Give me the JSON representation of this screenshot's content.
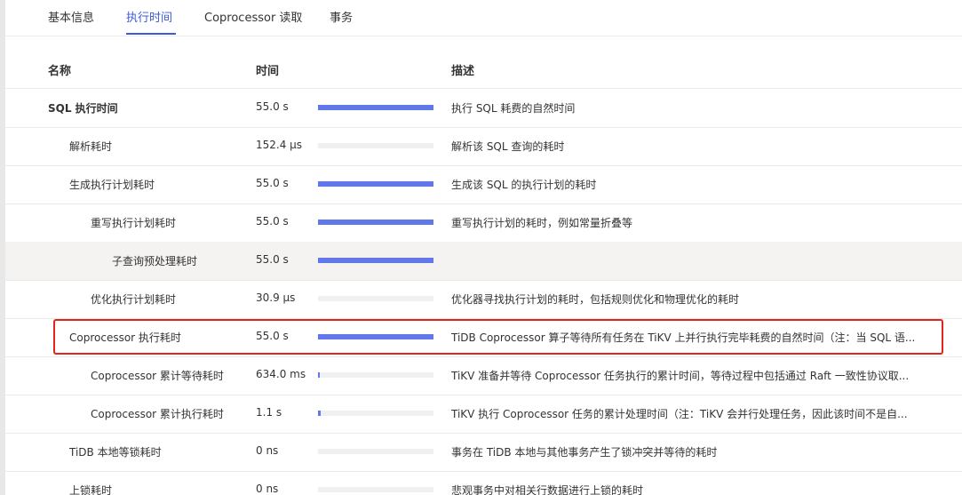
{
  "tabs": [
    {
      "label": "基本信息"
    },
    {
      "label": "执行时间"
    },
    {
      "label": "Coprocessor 读取"
    },
    {
      "label": "事务"
    }
  ],
  "active_tab": "执行时间",
  "table": {
    "headers": {
      "name": "名称",
      "time": "时间",
      "desc": "描述"
    },
    "rows": [
      {
        "name": "SQL 执行时间",
        "time": "55.0 s",
        "ratio": 1.0,
        "desc": "执行 SQL 耗费的自然时间"
      },
      {
        "name": "解析耗时",
        "time": "152.4 μs",
        "ratio": 0.0,
        "desc": "解析该 SQL 查询的耗时"
      },
      {
        "name": "生成执行计划耗时",
        "time": "55.0 s",
        "ratio": 1.0,
        "desc": "生成该 SQL 的执行计划的耗时"
      },
      {
        "name": "重写执行计划耗时",
        "time": "55.0 s",
        "ratio": 1.0,
        "desc": "重写执行计划的耗时，例如常量折叠等"
      },
      {
        "name": "子查询预处理耗时",
        "time": "55.0 s",
        "ratio": 1.0,
        "desc": ""
      },
      {
        "name": "优化执行计划耗时",
        "time": "30.9 μs",
        "ratio": 0.0,
        "desc": "优化器寻找执行计划的耗时，包括规则优化和物理优化的耗时"
      },
      {
        "name": "Coprocessor 执行耗时",
        "time": "55.0 s",
        "ratio": 1.0,
        "desc": "TiDB Coprocessor 算子等待所有任务在 TiKV 上并行执行完毕耗费的自然时间（注：当 SQL 语..."
      },
      {
        "name": "Coprocessor 累计等待耗时",
        "time": "634.0 ms",
        "ratio": 0.012,
        "desc": "TiKV 准备并等待 Coprocessor 任务执行的累计时间，等待过程中包括通过 Raft 一致性协议取..."
      },
      {
        "name": "Coprocessor 累计执行耗时",
        "time": "1.1 s",
        "ratio": 0.02,
        "desc": "TiKV 执行 Coprocessor 任务的累计处理时间（注：TiKV 会并行处理任务，因此该时间不是自..."
      },
      {
        "name": "TiDB 本地等锁耗时",
        "time": "0 ns",
        "ratio": 0.0,
        "desc": "事务在 TiDB 本地与其他事务产生了锁冲突并等待的耗时"
      },
      {
        "name": "上锁耗时",
        "time": "0 ns",
        "ratio": 0.0,
        "desc": "悲观事务中对相关行数据进行上锁的耗时"
      }
    ]
  },
  "colors": {
    "accent": "#3b59d9",
    "bar": "#6078ea",
    "highlight_box": "#e3241b",
    "hover_row": "#f4f3f2"
  }
}
